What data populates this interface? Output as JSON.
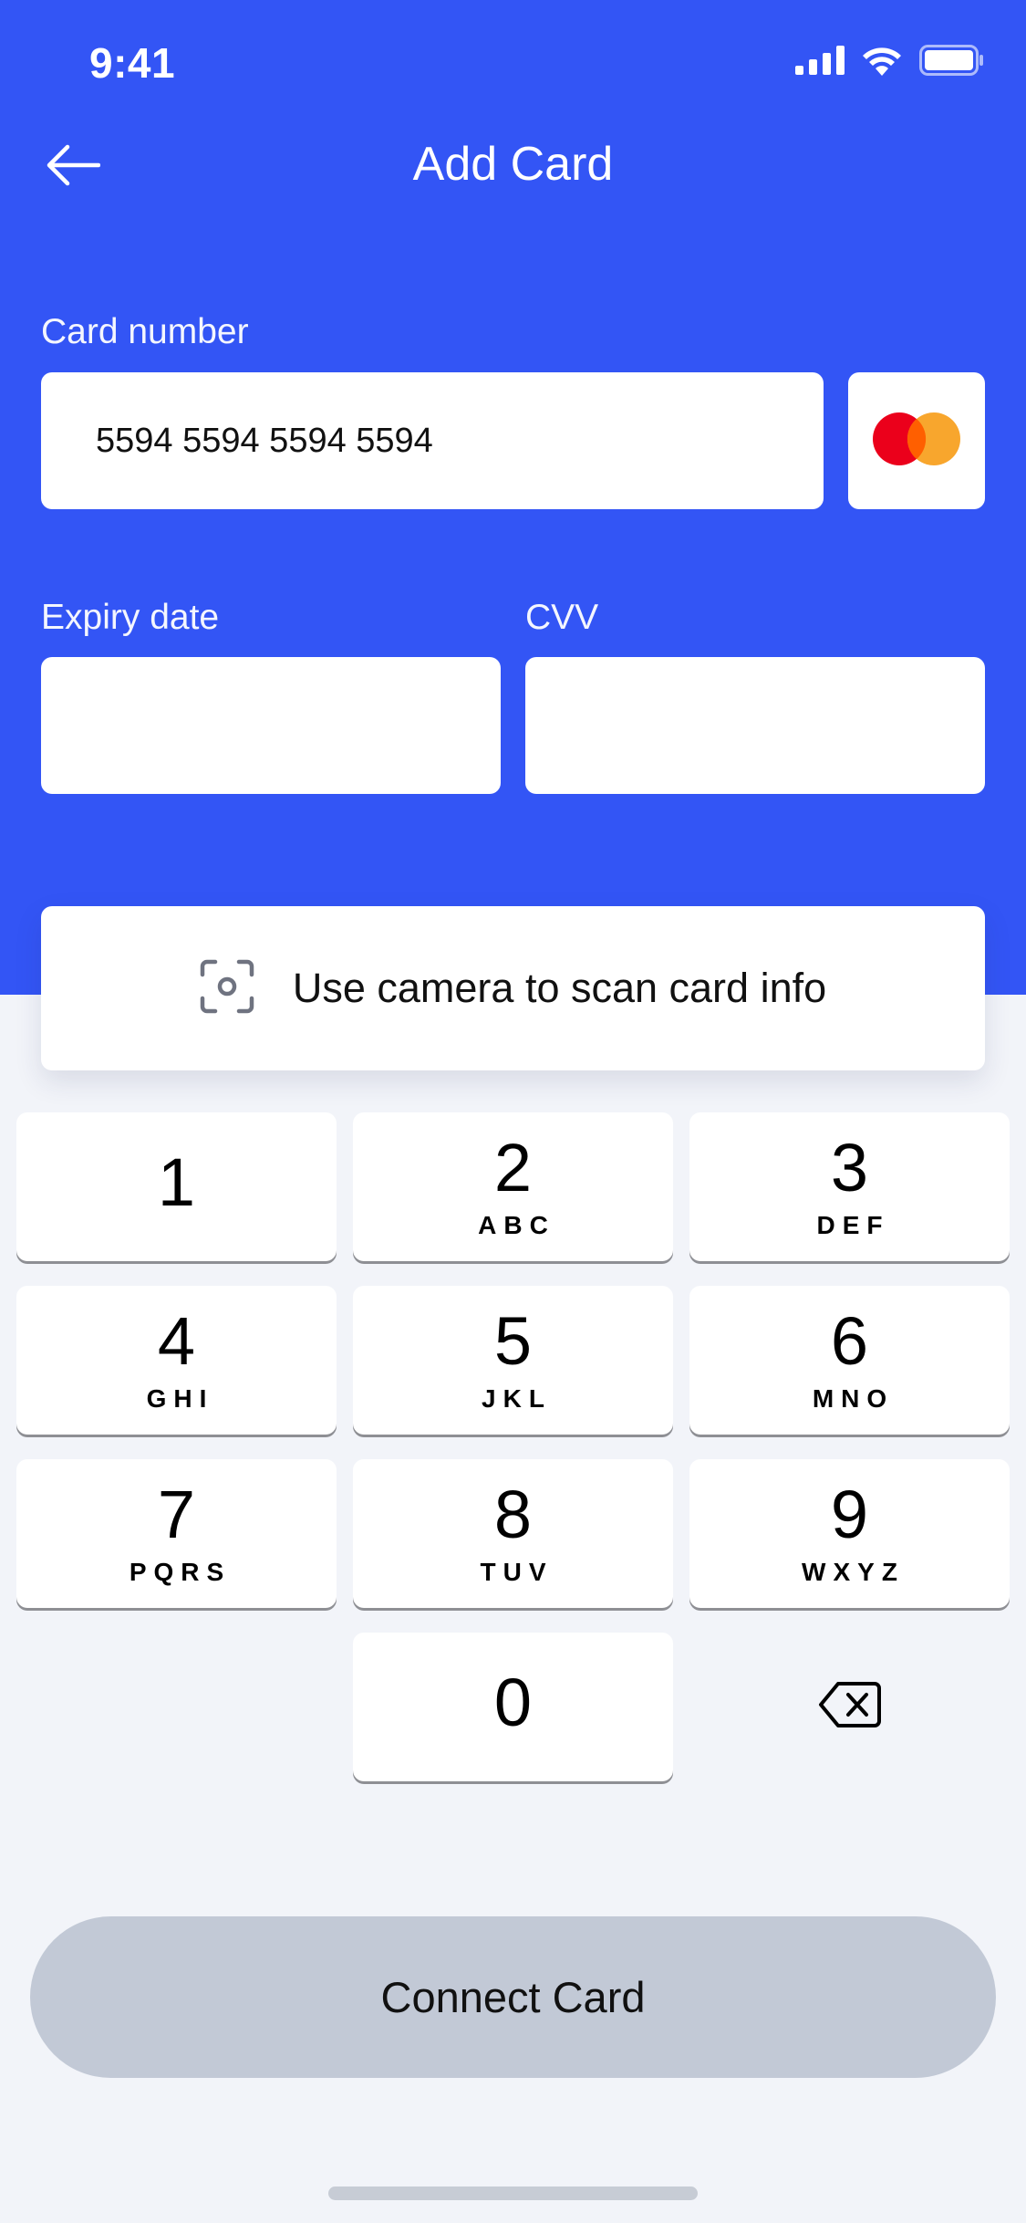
{
  "status_bar": {
    "time": "9:41"
  },
  "nav": {
    "title": "Add Card",
    "back_icon": "arrow-left-icon"
  },
  "form": {
    "card_number_label": "Card number",
    "card_number_value": "5594 5594 5594 5594",
    "card_brand_icon": "mastercard-icon",
    "expiry_label": "Expiry date",
    "expiry_value": "",
    "cvv_label": "CVV",
    "cvv_value": ""
  },
  "scan": {
    "label": "Use camera to scan card info",
    "icon": "camera-scan-icon"
  },
  "keypad": {
    "keys": [
      {
        "num": "1",
        "letters": ""
      },
      {
        "num": "2",
        "letters": "ABC"
      },
      {
        "num": "3",
        "letters": "DEF"
      },
      {
        "num": "4",
        "letters": "GHI"
      },
      {
        "num": "5",
        "letters": "JKL"
      },
      {
        "num": "6",
        "letters": "MNO"
      },
      {
        "num": "7",
        "letters": "PQRS"
      },
      {
        "num": "8",
        "letters": "TUV"
      },
      {
        "num": "9",
        "letters": "WXYZ"
      },
      {
        "num": "0",
        "letters": ""
      }
    ],
    "delete_icon": "backspace-icon"
  },
  "actions": {
    "connect_label": "Connect Card"
  },
  "colors": {
    "primary": "#3355F5",
    "background": "#F2F4F9",
    "disabled_button": "#C2C9D6",
    "mastercard_red": "#EB001B",
    "mastercard_orange": "#F79E1B"
  }
}
